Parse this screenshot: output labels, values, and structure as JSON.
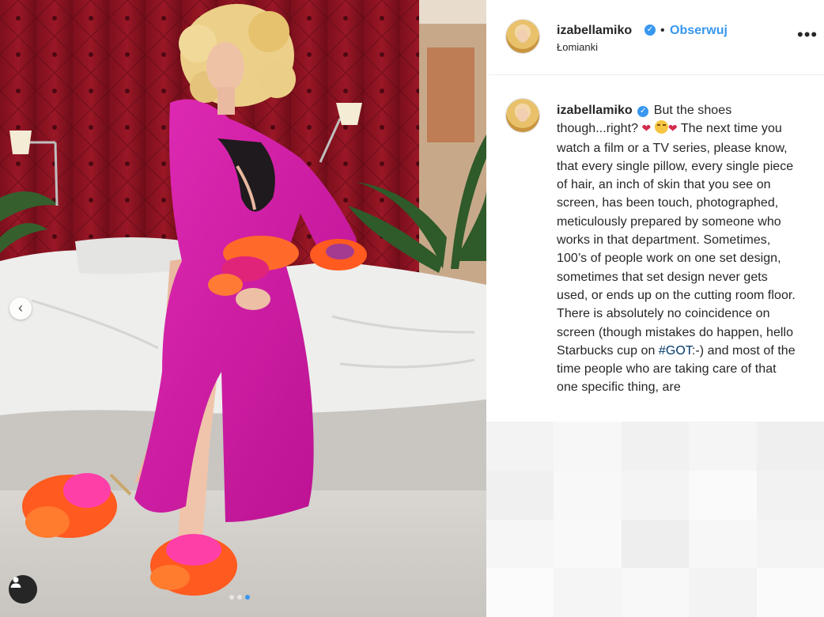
{
  "post": {
    "username": "izabellamiko",
    "follow_label": "Obserwuj",
    "separator": "•",
    "location": "Łomianki",
    "more_icon": "more-options-icon"
  },
  "caption": {
    "username": "izabellamiko",
    "text_part1": "But the shoes though...right? ",
    "heart1": "❤",
    "heart2": "❤",
    "text_part2": " The next time you watch a film or a TV series, please know, that every single pillow, every single piece of hair, an inch of skin that you see on screen, has been touch, photographed, meticulously prepared by someone who works in that department. Sometimes, 100’s of people work on one set design, sometimes that set design never gets used, or ends up on the cutting room floor. There is absolutely no coincidence on screen (though mistakes do happen, hello Starbucks cup on ",
    "hashtag": "#GOT",
    "text_part3": ":-) and most of the time people who are taking care of that one specific thing, are"
  },
  "carousel": {
    "dots": 3,
    "active_dot": 3
  },
  "colors": {
    "accent": "#3897f0",
    "robe": "#d21fa8",
    "wall": "#8a1320",
    "feather": "#ff5a1f"
  },
  "pixelation": [
    "#f3f3f3",
    "#f7f7f7",
    "#f1f1f1",
    "#f5f5f5",
    "#efefef",
    "#f0f0f0",
    "#f8f8f8",
    "#f4f4f4",
    "#fafafa",
    "#f2f2f2",
    "#f6f6f6",
    "#f9f9f9",
    "#eeeeee",
    "#f7f7f7",
    "#f4f4f4",
    "#fbfbfb",
    "#f5f5f5",
    "#f8f8f8",
    "#f3f3f3",
    "#fafafa"
  ]
}
